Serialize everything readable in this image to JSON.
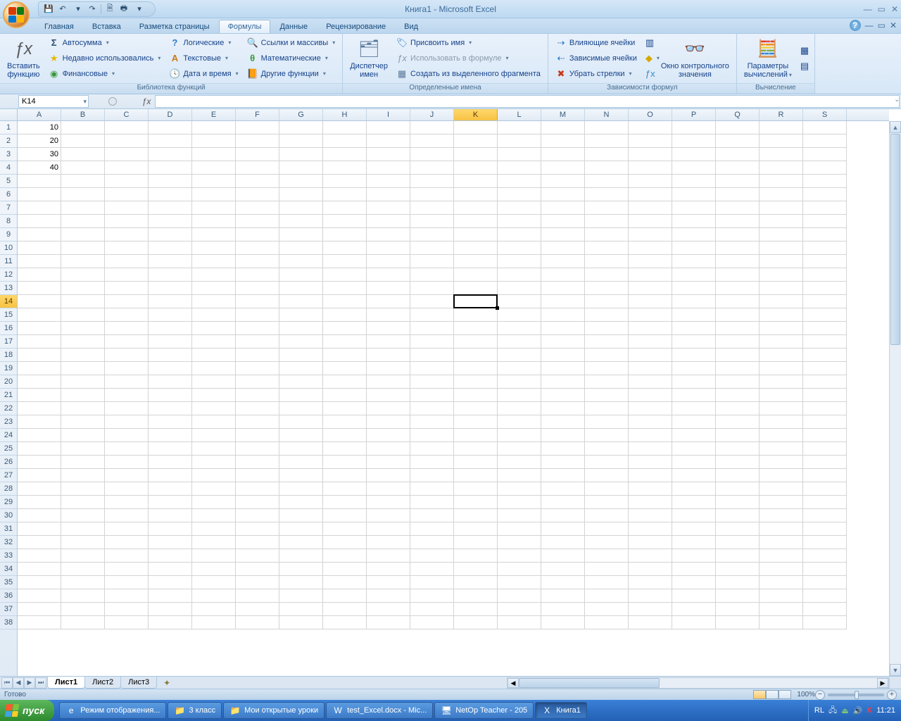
{
  "window": {
    "title": "Книга1 - Microsoft Excel"
  },
  "qat": {
    "save": "💾",
    "undo": "↶",
    "redo": "↷",
    "print_preview": "🗎",
    "quick_print": "🖶"
  },
  "tabs": {
    "home": "Главная",
    "insert": "Вставка",
    "layout": "Разметка страницы",
    "formulas": "Формулы",
    "data": "Данные",
    "review": "Рецензирование",
    "view": "Вид",
    "active": "formulas"
  },
  "ribbon": {
    "group1": {
      "label": "Библиотека функций",
      "insert_fn": "Вставить\nфункцию",
      "autosum": "Автосумма",
      "recent": "Недавно использовались",
      "financial": "Финансовые",
      "logical": "Логические",
      "text": "Текстовые",
      "datetime": "Дата и время",
      "lookup": "Ссылки и массивы",
      "math": "Математические",
      "more": "Другие функции"
    },
    "group2": {
      "label": "Определенные имена",
      "name_mgr": "Диспетчер\nимен",
      "define_name": "Присвоить имя",
      "use_in_formula": "Использовать в формуле",
      "create_from_sel": "Создать из выделенного фрагмента"
    },
    "group3": {
      "label": "Зависимости формул",
      "trace_prec": "Влияющие ячейки",
      "trace_dep": "Зависимые ячейки",
      "remove_arrows": "Убрать стрелки",
      "watch_window": "Окно контрольного\nзначения"
    },
    "group4": {
      "label": "Вычисление",
      "calc_opts": "Параметры\nвычислений"
    }
  },
  "namebox": {
    "value": "K14"
  },
  "formulabar": {
    "value": ""
  },
  "columns": [
    "A",
    "B",
    "C",
    "D",
    "E",
    "F",
    "G",
    "H",
    "I",
    "J",
    "K",
    "L",
    "M",
    "N",
    "O",
    "P",
    "Q",
    "R",
    "S"
  ],
  "row_count": 38,
  "selected_col": "K",
  "selected_row": 14,
  "cells": {
    "A1": "10",
    "A2": "20",
    "A3": "30",
    "A4": "40"
  },
  "sheets": {
    "tabs": [
      "Лист1",
      "Лист2",
      "Лист3"
    ],
    "active": 0
  },
  "statusbar": {
    "ready": "Готово",
    "zoom": "100%"
  },
  "taskbar": {
    "start": "пуск",
    "items": [
      {
        "icon": "e",
        "label": "Режим отображения..."
      },
      {
        "icon": "📁",
        "label": "3 класс"
      },
      {
        "icon": "📁",
        "label": "Мои открытые уроки"
      },
      {
        "icon": "W",
        "label": "test_Excel.docx - Mic..."
      },
      {
        "icon": "🖥",
        "label": "NetOp Teacher - 205"
      },
      {
        "icon": "X",
        "label": "Книга1",
        "active": true
      }
    ],
    "tray": {
      "lang": "RL",
      "time": "11:21"
    }
  }
}
